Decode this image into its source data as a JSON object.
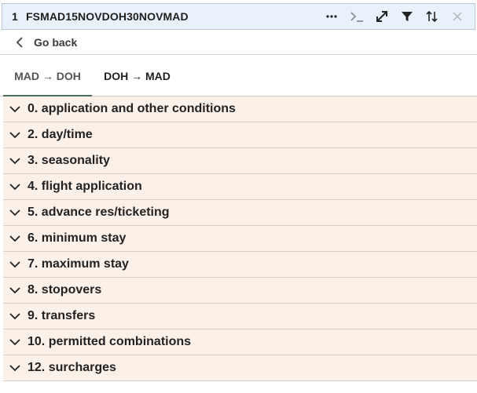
{
  "header": {
    "number": "1",
    "title": "FSMAD15NOVDOH30NOVMAD",
    "icons": [
      "more-icon",
      "terminal-icon",
      "expand-icon",
      "filter-icon",
      "sort-icon",
      "close-icon"
    ]
  },
  "goback": {
    "label": "Go back"
  },
  "tabs": [
    {
      "label": "MAD → DOH",
      "active": true
    },
    {
      "label": "DOH → MAD",
      "active": false
    }
  ],
  "sections": [
    {
      "label": "0. application and other conditions"
    },
    {
      "label": "2. day/time"
    },
    {
      "label": "3. seasonality"
    },
    {
      "label": "4. flight application"
    },
    {
      "label": "5. advance res/ticketing"
    },
    {
      "label": "6. minimum stay"
    },
    {
      "label": "7. maximum stay"
    },
    {
      "label": "8. stopovers"
    },
    {
      "label": "9. transfers"
    },
    {
      "label": "10. permitted combinations"
    },
    {
      "label": "12. surcharges"
    }
  ],
  "colors": {
    "header_bg": "#e9f2fb",
    "row_bg": "#fcf1e9",
    "active_tab_underline": "#4a6b5e"
  }
}
